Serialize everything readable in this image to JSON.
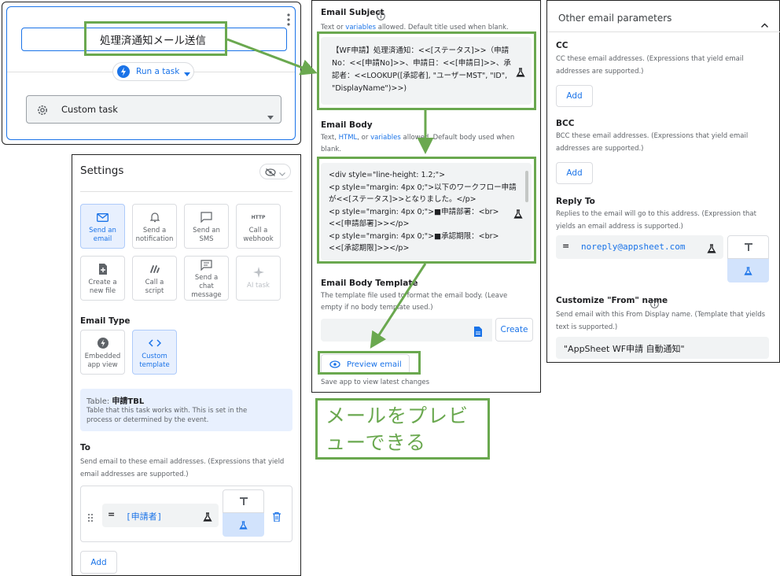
{
  "task_panel": {
    "task_name": "処理済通知メール送信",
    "run_label": "Run a task",
    "custom_task_label": "Custom task"
  },
  "settings": {
    "title": "Settings",
    "actions": [
      {
        "label": "Send an email",
        "icon": "mail-icon"
      },
      {
        "label": "Send a notification",
        "icon": "bell-icon"
      },
      {
        "label": "Send an SMS",
        "icon": "sms-icon"
      },
      {
        "label": "Call a webhook",
        "icon": "http-icon",
        "glyph": "HTTP"
      },
      {
        "label": "Create a new file",
        "icon": "add-file-icon"
      },
      {
        "label": "Call a script",
        "icon": "script-icon"
      },
      {
        "label": "Send a chat message",
        "icon": "chat-icon"
      },
      {
        "label": "AI task",
        "icon": "sparkle-icon"
      }
    ],
    "email_type_label": "Email Type",
    "email_types": [
      {
        "label": "Embedded app view",
        "icon": "bolt-icon"
      },
      {
        "label": "Custom template",
        "icon": "code-icon"
      }
    ],
    "table_prefix": "Table: ",
    "table_name": "申請TBL",
    "table_desc": "Table that this task works with. This is set in the process or determined by the event.",
    "to_label": "To",
    "to_desc": "Send email to these email addresses. (Expressions that yield email addresses are supported.)",
    "to_equals": "=",
    "to_value": "[申請者]",
    "add_label": "Add"
  },
  "email": {
    "subject_label": "Email Subject",
    "subject_help_pre": "Text or ",
    "subject_help_link": "variables",
    "subject_help_post": " allowed. Default title used when blank.",
    "subject_value": "【WF申請】処理済通知：<<[ステータス]>>（申請No：<<[申請No]>>、申請日：<<[申請日]>>、承認者：<<LOOKUP([承認者], \"ユーザーMST\", \"ID\", \"DisplayName\")>>)",
    "body_label": "Email Body",
    "body_help_pre": "Text, ",
    "body_help_link1": "HTML",
    "body_help_mid": ", or ",
    "body_help_link2": "variables",
    "body_help_post": " allowed. Default body used when blank.",
    "body_value": "<div style=\"line-height: 1.2;\">\n<p style=\"margin: 4px 0;\">以下のワークフロー申請が<<[ステータス]>>となりました。</p>\n<p style=\"margin: 4px 0;\">■申請部署：<br><<[申請部署]>></p>\n<p style=\"margin: 4px 0;\">■承認期限：<br><<[承認期限]>></p>",
    "template_label": "Email Body Template",
    "template_desc": "The template file used to format the email body. (Leave empty if no body template used.)",
    "create_label": "Create",
    "preview_label": "Preview email",
    "save_note": "Save app to view latest changes"
  },
  "other": {
    "title": "Other email parameters",
    "cc_label": "CC",
    "cc_desc": "CC these email addresses. (Expressions that yield email addresses are supported.)",
    "bcc_label": "BCC",
    "bcc_desc": "BCC these email addresses. (Expressions that yield email addresses are supported.)",
    "add_label": "Add",
    "reply_label": "Reply To",
    "reply_desc": "Replies to the email will go to this address. (Expression that yields an email address is supported.)",
    "reply_equals": "=",
    "reply_value": "noreply@appsheet.com",
    "from_label": "Customize \"From\" name",
    "from_desc": "Send email with this From Display name. (Template that yields text is supported.)",
    "from_value": "\"AppSheet WF申請 自動通知\""
  },
  "callout": {
    "text": "メールをプレビューできる"
  },
  "colors": {
    "accent": "#1a73e8",
    "highlight": "#6aa84f",
    "callout_text": "#6aa84f"
  }
}
